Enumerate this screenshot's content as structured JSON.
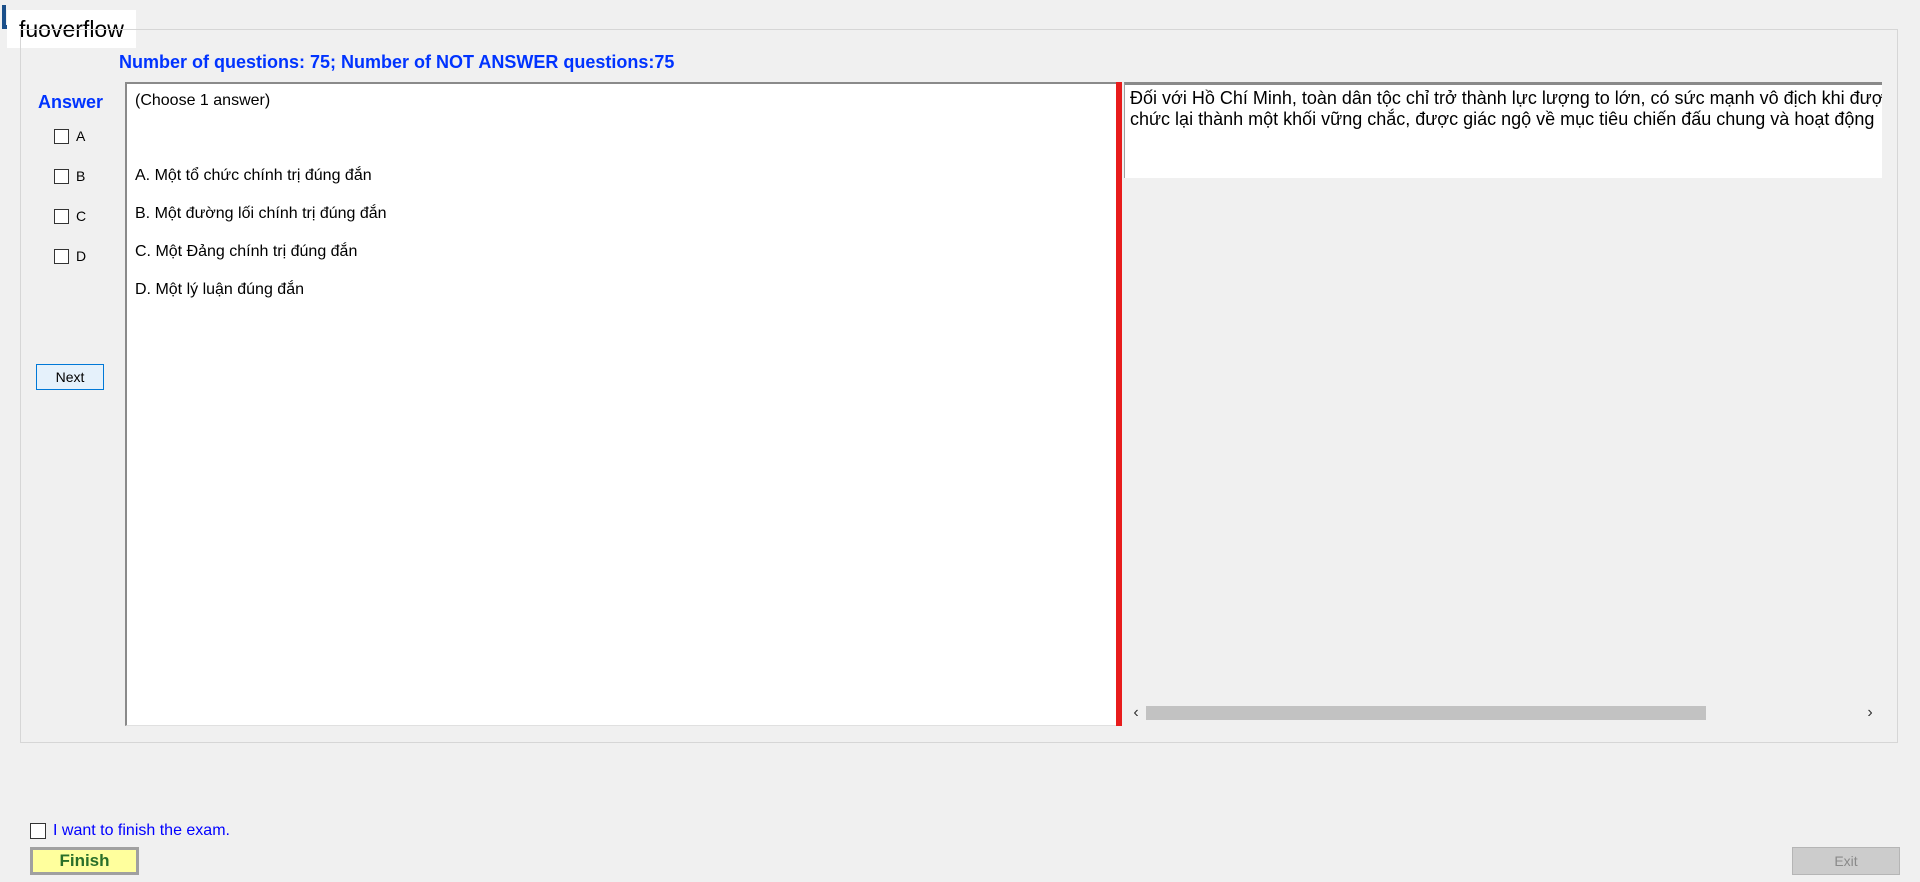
{
  "brand": {
    "label": "fuoverflow"
  },
  "status": {
    "text": "Number of questions: 75; Number of NOT ANSWER questions:75"
  },
  "answer_panel": {
    "title": "Answer",
    "options": [
      "A",
      "B",
      "C",
      "D"
    ],
    "next_label": "Next"
  },
  "question_panel": {
    "instruction": "(Choose 1 answer)",
    "options": [
      "A.  Một tổ chức chính trị đúng đắn",
      "B.  Một đường lối chính trị đúng đắn",
      "C.  Một Đảng chính trị đúng đắn",
      "D.  Một lý luận đúng đắn"
    ]
  },
  "question_text": {
    "line1": "Đối với Hồ Chí Minh, toàn dân tộc chỉ trở thành lực lượng to lớn, có sức mạnh vô địch khi được",
    "line2": "chức lại thành một khối vững chắc, được giác ngộ về mục tiêu chiến đấu chung và hoạt động"
  },
  "scrollbar": {
    "left_arrow": "‹",
    "right_arrow": "›"
  },
  "footer": {
    "finish_check_label": "I want to finish the exam.",
    "finish_label": "Finish",
    "exit_label": "Exit"
  },
  "colors": {
    "accent_blue": "#0033ff",
    "splitter_red": "#e81c1c",
    "finish_bg": "#ffff9d",
    "finish_text": "#2a6f2a"
  }
}
